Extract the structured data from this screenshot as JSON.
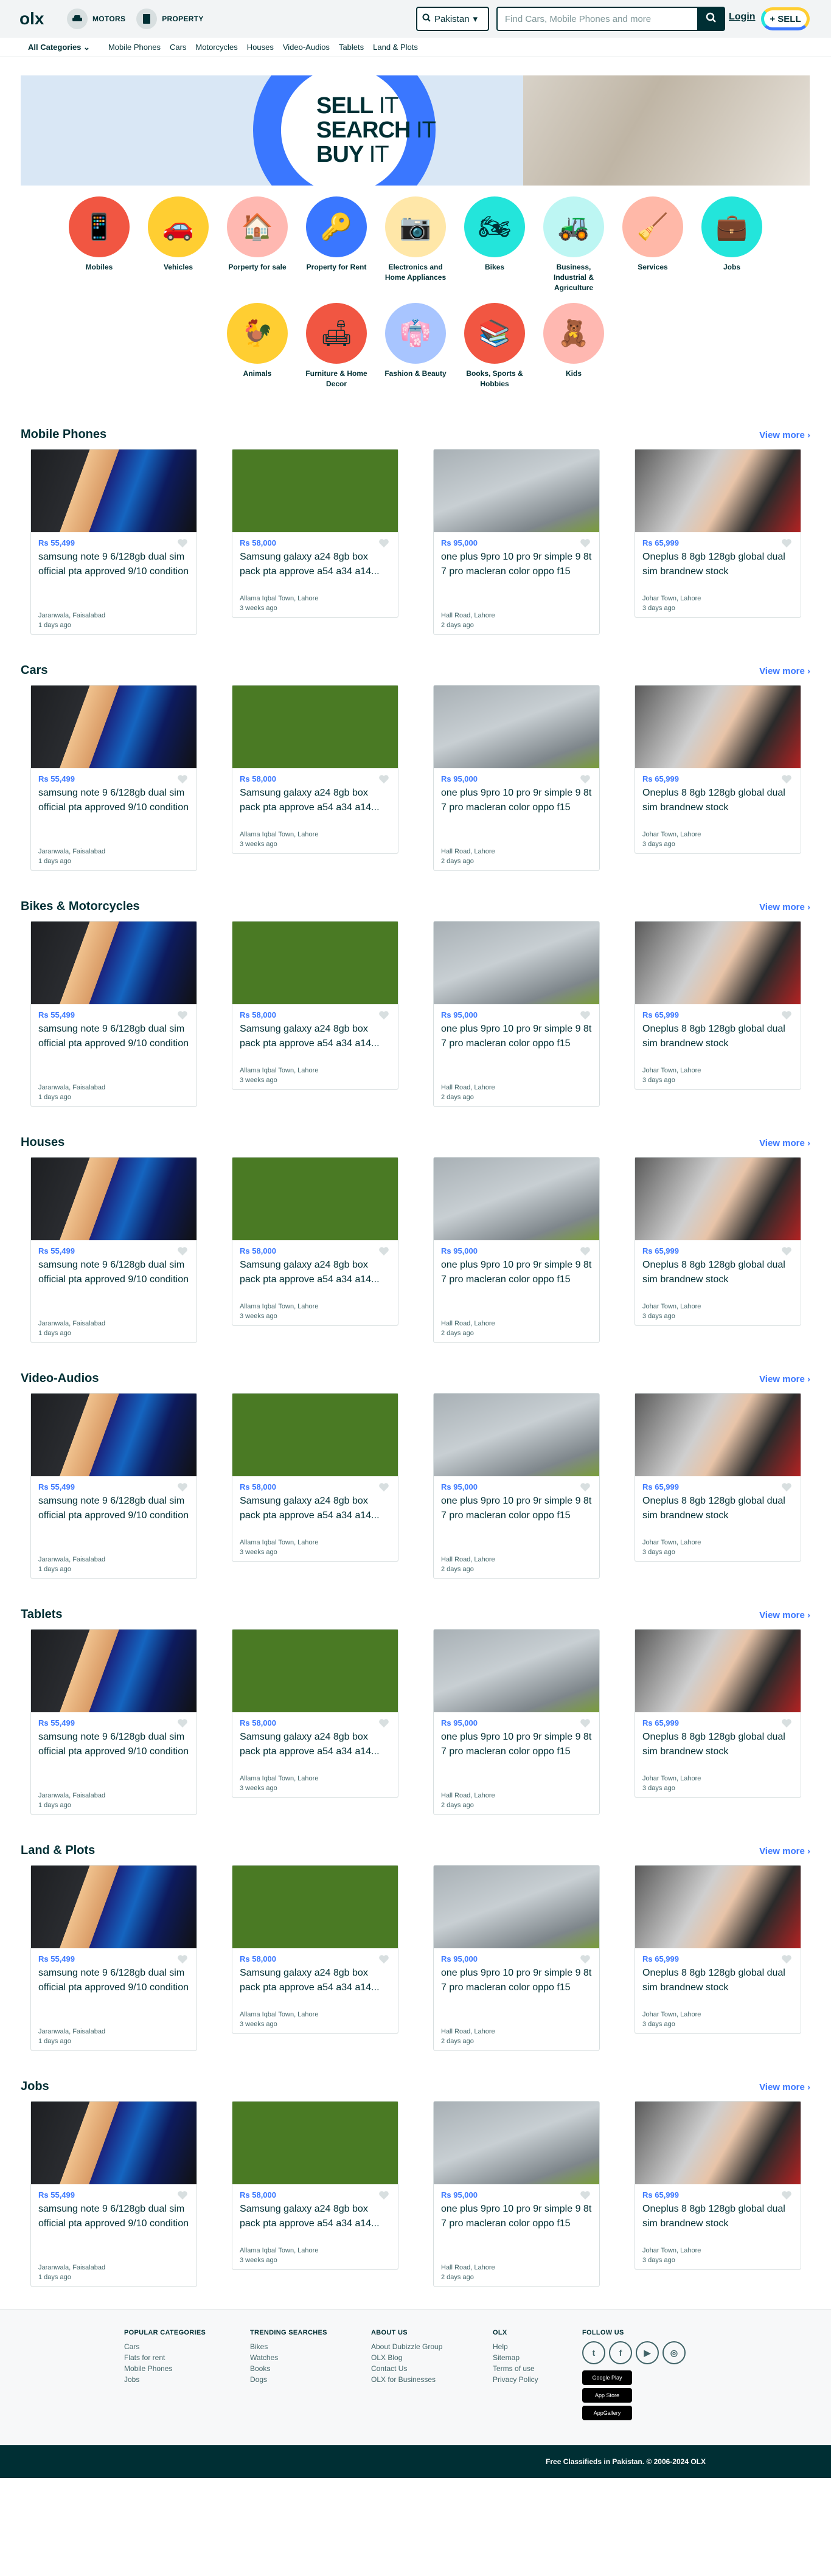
{
  "header": {
    "verticals": [
      {
        "label": "MOTORS"
      },
      {
        "label": "PROPERTY"
      }
    ],
    "location": "Pakistan",
    "search_placeholder": "Find Cars, Mobile Phones and more",
    "login": "Login",
    "sell": "SELL"
  },
  "catnav": {
    "all": "All Categories",
    "links": [
      "Mobile Phones",
      "Cars",
      "Motorcycles",
      "Houses",
      "Video-Audios",
      "Tablets",
      "Land & Plots"
    ]
  },
  "banner": {
    "line1a": "SELL",
    "line1b": "IT",
    "line2a": "SEARCH",
    "line2b": "IT",
    "line3a": "BUY",
    "line3b": "IT"
  },
  "categories": [
    {
      "name": "Mobiles",
      "color": "#f15642",
      "icon": "📱"
    },
    {
      "name": "Vehicles",
      "color": "#ffce32",
      "icon": "🚗"
    },
    {
      "name": "Porperty for sale",
      "color": "#ffb8b1",
      "icon": "🏠"
    },
    {
      "name": "Property for Rent",
      "color": "#3a77ff",
      "icon": "🔑"
    },
    {
      "name": "Electronics and Home Appliances",
      "color": "#ffe7a8",
      "icon": "📷"
    },
    {
      "name": "Bikes",
      "color": "#23e5db",
      "icon": "🏍"
    },
    {
      "name": "Business, Industrial & Agriculture",
      "color": "#bdf6f3",
      "icon": "🚜"
    },
    {
      "name": "Services",
      "color": "#ffb8a8",
      "icon": "🧹"
    },
    {
      "name": "Jobs",
      "color": "#23e5db",
      "icon": "💼"
    },
    {
      "name": "Animals",
      "color": "#ffce32",
      "icon": "🐓"
    },
    {
      "name": "Furniture & Home Decor",
      "color": "#f15642",
      "icon": "🛋"
    },
    {
      "name": "Fashion & Beauty",
      "color": "#a8c5ff",
      "icon": "👘"
    },
    {
      "name": "Books, Sports & Hobbies",
      "color": "#f15642",
      "icon": "📚"
    },
    {
      "name": "Kids",
      "color": "#ffb8b1",
      "icon": "🧸"
    }
  ],
  "listings": [
    {
      "price": "Rs 55,499",
      "title": "samsung note 9 6/128gb dual sim official pta approved 9/10 condition",
      "location": "Jaranwala, Faisalabad",
      "time": "1 days ago"
    },
    {
      "price": "Rs 58,000",
      "title": "Samsung galaxy a24 8gb box pack pta approve a54 a34 a14...",
      "location": "Allama Iqbal Town, Lahore",
      "time": "3 weeks ago"
    },
    {
      "price": "Rs 95,000",
      "title": "one plus 9pro 10 pro 9r simple 9 8t 7 pro macleran color oppo f15",
      "location": "Hall Road, Lahore",
      "time": "2 days ago"
    },
    {
      "price": "Rs 65,999",
      "title": "Oneplus 8 8gb 128gb global dual sim brandnew stock",
      "location": "Johar Town, Lahore",
      "time": "3 days ago"
    }
  ],
  "sections": [
    {
      "title": "Mobile Phones",
      "view_more": "View more"
    },
    {
      "title": "Cars",
      "view_more": "View more"
    },
    {
      "title": "Bikes & Motorcycles",
      "view_more": "View more"
    },
    {
      "title": "Houses",
      "view_more": "View more"
    },
    {
      "title": "Video-Audios",
      "view_more": "View more"
    },
    {
      "title": "Tablets",
      "view_more": "View more"
    },
    {
      "title": "Land & Plots",
      "view_more": "View more"
    },
    {
      "title": "Jobs",
      "view_more": "View more"
    }
  ],
  "footer": {
    "popular": {
      "title": "POPULAR CATEGORIES",
      "links": [
        "Cars",
        "Flats for rent",
        "Mobile Phones",
        "Jobs"
      ]
    },
    "trending": {
      "title": "TRENDING SEARCHES",
      "links": [
        "Bikes",
        "Watches",
        "Books",
        "Dogs"
      ]
    },
    "about": {
      "title": "ABOUT US",
      "links": [
        "About Dubizzle Group",
        "OLX Blog",
        "Contact Us",
        "OLX for Businesses"
      ]
    },
    "olx": {
      "title": "OLX",
      "links": [
        "Help",
        "Sitemap",
        "Terms of use",
        "Privacy Policy"
      ]
    },
    "follow": {
      "title": "FOLLOW US"
    },
    "stores": [
      "Google Play",
      "App Store",
      "AppGallery"
    ],
    "copyright_bold": "Free Classifieds in Pakistan",
    "copyright": ". © 2006-2024 OLX"
  }
}
